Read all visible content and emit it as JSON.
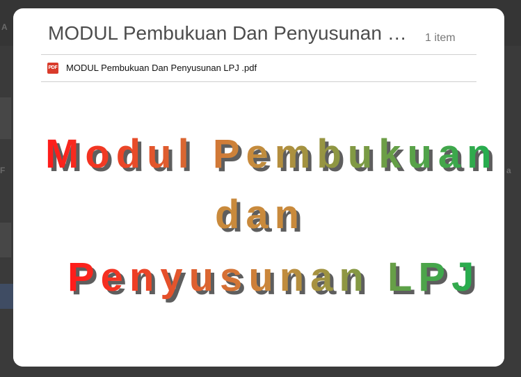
{
  "dialog": {
    "title": "MODUL Pembukuan Dan Penyusunan LPJ",
    "item_count": "1 item"
  },
  "file": {
    "icon": "pdf-icon",
    "icon_label": "PDF",
    "name": "MODUL Pembukuan Dan Penyusunan LPJ .pdf"
  },
  "preview": {
    "lines": [
      "Modul Pembukuan",
      "dan",
      "Penyusunan LPJ"
    ]
  },
  "background": {
    "fragments": [
      "A",
      "F",
      "a"
    ]
  },
  "colors": {
    "gradient_start": "#ff1a1a",
    "gradient_mid": "#c98a3c",
    "gradient_end": "#1fae4f",
    "shadow": "#5e5e5e"
  }
}
